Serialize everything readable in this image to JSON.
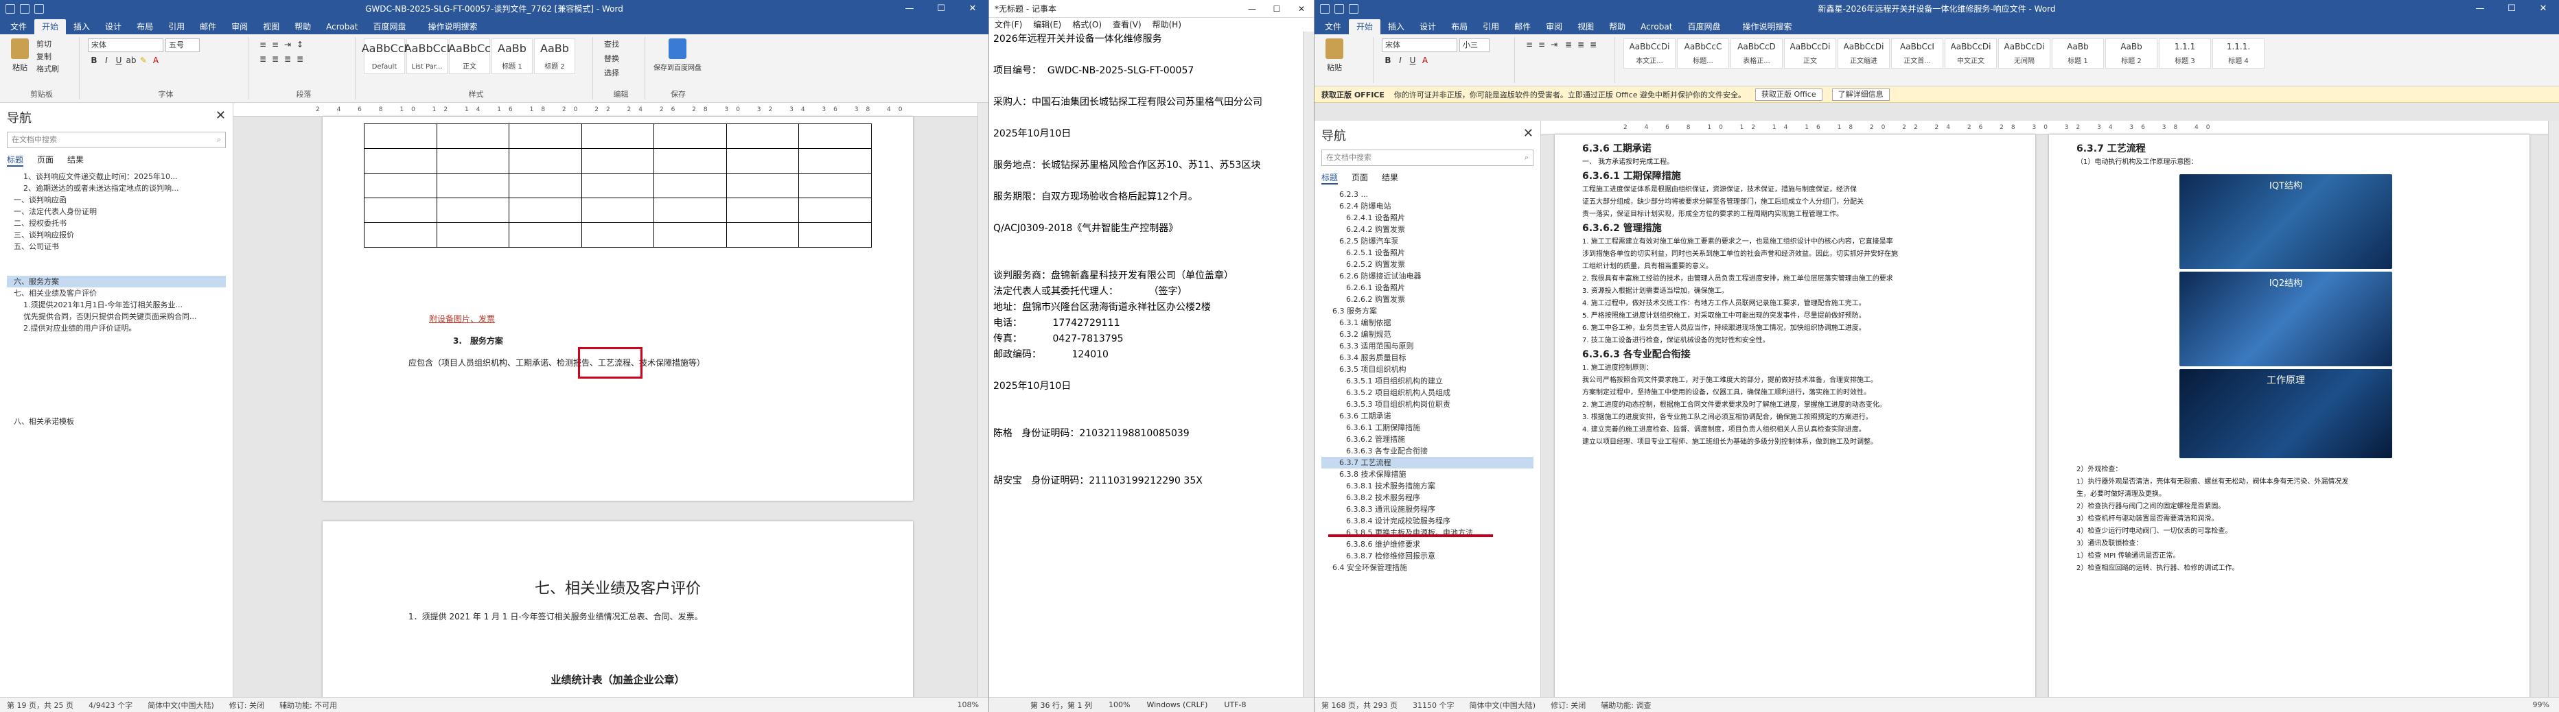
{
  "w1": {
    "title": "GWDC-NB-2025-SLG-FT-00057-谈判文件_7762 [兼容模式] - Word",
    "tabs": [
      "文件",
      "开始",
      "插入",
      "设计",
      "布局",
      "引用",
      "邮件",
      "审阅",
      "视图",
      "帮助",
      "Acrobat",
      "百度网盘",
      "操作说明搜索"
    ],
    "clipboard": {
      "paste": "粘贴",
      "cut": "剪切",
      "copy": "复制",
      "fmt": "格式刷",
      "label": "剪贴板"
    },
    "font": {
      "name": "宋体",
      "size": "五号",
      "label": "字体"
    },
    "para_label": "段落",
    "styles": [
      {
        "pv": "AaBbCcI",
        "nm": "Default"
      },
      {
        "pv": "AaBbCcI",
        "nm": "List Par..."
      },
      {
        "pv": "AaBbCc",
        "nm": "正文"
      },
      {
        "pv": "AaBb",
        "nm": "标题 1"
      },
      {
        "pv": "AaBb",
        "nm": "标题 2"
      }
    ],
    "styles_label": "样式",
    "edit": {
      "find": "查找",
      "replace": "替换",
      "select": "选择",
      "label": "编辑"
    },
    "baidu": {
      "save": "保存到百度网盘",
      "label": "保存"
    },
    "nav": {
      "title": "导航",
      "search": "在文档中搜索",
      "tabs": [
        "标题",
        "页面",
        "结果"
      ]
    },
    "nav_items": [
      "1、谈判响应文件递交截止时间：2025年10...",
      "2、逾期送达的或者未送达指定地点的谈判响...",
      "一、谈判响应函",
      "一、法定代表人身份证明",
      "二、授权委托书",
      "三、谈判响应报价",
      "五、公司证书",
      "",
      "",
      "六、服务方案",
      "七、相关业绩及客户评价",
      "1.须提供2021年1月1日-今年签订相关服务业...",
      "优先提供合同，否则只提供合同关键页面采购合同...",
      "2.提供对应业绩的用户评价证明。",
      "",
      "",
      "",
      "",
      "",
      "",
      "",
      "八、相关承诺模板"
    ],
    "doc": {
      "redline": "附设备图片、发票",
      "heading": "3.　服务方案",
      "content": "应包含（项目人员组织机构、工期承诺、检测报告、工艺流程、技术保障措施等）",
      "section": "七、相关业绩及客户评价",
      "desc": "1．须提供 2021 年 1 月 1 日-今年签订相关服务业绩情况汇总表、合同、发票。",
      "table_title": "业绩统计表（加盖企业公章）"
    },
    "status": {
      "page": "第 19 页，共 25 页",
      "words": "4/9423 个字",
      "lang": "简体中文(中国大陆)",
      "rev": "修订: 关闭",
      "acc": "辅助功能: 不可用",
      "zoom": "108%"
    }
  },
  "w2": {
    "title": "*无标题 - 记事本",
    "menu": [
      "文件(F)",
      "编辑(E)",
      "格式(O)",
      "查看(V)",
      "帮助(H)"
    ],
    "lines": [
      "2026年远程开关并设备一体化维修服务",
      "",
      "项目编号：  GWDC-NB-2025-SLG-FT-00057",
      "",
      "采购人：中国石油集团长城钻探工程有限公司苏里格气田分公司",
      "",
      "2025年10月10日",
      "",
      "服务地点：长城钻探苏里格风险合作区苏10、苏11、苏53区块",
      "",
      "服务期限：自双方现场验收合格后起算12个月。",
      "",
      "Q/ACJ0309-2018《气井智能生产控制器》",
      "",
      "",
      "谈判服务商：盘锦新鑫星科技开发有限公司（单位盖章）",
      "法定代表人或其委托代理人：          （签字）",
      "地址：盘锦市兴隆台区渤海街道永祥社区办公楼2楼",
      "电话：          17742729111",
      "传真：          0427-7813795",
      "邮政编码：          124010",
      "",
      "2025年10月10日",
      "",
      "",
      "陈格   身份证明码：210321198810085039",
      "",
      "",
      "胡安宝   身份证明码：211103199212290 35X"
    ],
    "status": {
      "pos": "第 36 行，第 1 列",
      "zoom": "100%",
      "eol": "Windows (CRLF)",
      "enc": "UTF-8"
    }
  },
  "w3": {
    "title": "新鑫星-2026年远程开关并设备一体化维修服务-响应文件 - Word",
    "tabs": [
      "文件",
      "开始",
      "插入",
      "设计",
      "布局",
      "引用",
      "邮件",
      "审阅",
      "视图",
      "帮助",
      "Acrobat",
      "百度网盘",
      "操作说明搜索"
    ],
    "font": {
      "name": "宋体",
      "size": "小三"
    },
    "styles": [
      {
        "pv": "AaBbCcDi",
        "nm": "本文正..."
      },
      {
        "pv": "AaBbCcC",
        "nm": "标题..."
      },
      {
        "pv": "AaBbCcD",
        "nm": "表格正..."
      },
      {
        "pv": "AaBbCcDi",
        "nm": "正文"
      },
      {
        "pv": "AaBbCcDi",
        "nm": "正文缩进"
      },
      {
        "pv": "AaBbCcI",
        "nm": "正文首..."
      },
      {
        "pv": "AaBbCcDi",
        "nm": "中文正文"
      },
      {
        "pv": "AaBbCcDi",
        "nm": "无间隔"
      },
      {
        "pv": "AaBb",
        "nm": "标题 1"
      },
      {
        "pv": "AaBb",
        "nm": "标题 2"
      },
      {
        "pv": "1.1.1",
        "nm": "标题 3"
      },
      {
        "pv": "1.1.1.",
        "nm": "标题 4"
      }
    ],
    "msg": {
      "label": "获取正版 OFFICE",
      "text": "你的许可证并非正版，你可能是盗版软件的受害者。立即通过正版 Office 避免中断并保护你的文件安全。",
      "btn1": "获取正版 Office",
      "btn2": "了解详细信息"
    },
    "nav": {
      "title": "导航",
      "search": "在文档中搜索",
      "tabs": [
        "标题",
        "页面",
        "结果"
      ]
    },
    "nav_items": [
      "6.2.3 ...",
      "6.2.4 防爆电站",
      "6.2.4.1 设备照片",
      "6.2.4.2 购置发票",
      "6.2.5 防爆汽车泵",
      "6.2.5.1 设备照片",
      "6.2.5.2 购置发票",
      "6.2.6 防爆接近试油电器",
      "6.2.6.1 设备照片",
      "6.2.6.2 购置发票",
      "6.3 服务方案",
      "6.3.1 编制依据",
      "6.3.2 编制规范",
      "6.3.3 适用范围与原则",
      "6.3.4 服务质量目标",
      "6.3.5 项目组织机构",
      "6.3.5.1 项目组织机构的建立",
      "6.3.5.2 项目组织机构人员组成",
      "6.3.5.3 项目组织机构岗位职责",
      "6.3.6 工期承诺",
      "6.3.6.1 工期保障措施",
      "6.3.6.2 管理措施",
      "6.3.6.3 各专业配合衔接",
      "6.3.7 工艺流程",
      "6.3.8 技术保障措施",
      "6.3.8.1 技术服务措施方案",
      "6.3.8.2 技术服务程序",
      "6.3.8.3 通讯设施服务程序",
      "6.3.8.4 设计完成校验服务程序",
      "6.3.8.5 更换主板及电源板、电池方法",
      "6.3.8.6 维护维修要求",
      "6.3.8.7 检修维修回报示意",
      "6.4 安全环保管理措施"
    ],
    "doc_left": {
      "h1": "6.3.6 工期承诺",
      "sub1": "一、 我方承诺按时完成工程。",
      "h2": "6.3.6.1 工期保障措施",
      "p1": [
        "工程施工进度保证体系是根据由组织保证，资源保证，技术保证，措施与制度保证，经济保",
        "证五大部分组成，缺少部分均将被要求分解至各管理部门，施工后组成立个人分组门，分配关",
        "责一落实，保证目标计划实现，形成全方位的要求的工程周期内实现施工程管理工作。"
      ],
      "h3": "6.3.6.2 管理措施",
      "p2": [
        "1. 施工工程需建立有效对施工单位施工要素的要求之一，也是施工组织设计中的核心内容，它直接是率",
        "涉到措施各单位的切实利益，同时也关系到施工单位的社会声誉和经济效益。因此，切实抓好并安好在施",
        "工组织计划的质量，具有相当重要的意义。",
        "2. 我很具有丰富施工经验的技术，由管理人员负责工程进度安排，施工单位层层落实管理由施工的要求",
        "3. 资源投入根据计划需要适当增加，确保施工。",
        "4. 施工过程中，做好技术交底工作：有地方工作人员联网记录施工要求，管理配合施工完工。",
        "5. 严格按照施工进度计划组织施工，对采取施工中可能出现的突发事件，尽量提前做好预防。",
        "6. 施工中各工种，业务员主管人员应当作，持续跟进现场施工情况，加快组织协调施工进度。",
        "7. 技工施工设备进行检查，保证机械设备的完好性和安全性。"
      ],
      "h4": "6.3.6.3 各专业配合衔接",
      "p3": [
        "1. 施工进度控制原则：",
        "我公司严格按照合同文件要求施工，对于施工难度大的部分，提前做好技术准备，合理安排施工。",
        "方案制定过程中，坚持施工中使用的设备，仪器工具，确保施工顺利进行，落实施工的时效性。",
        "2. 施工进度的动态控制，根据施工合同文件要求要求及时了解施工进度，掌握施工进度的动态变化。",
        "3. 根据施工的进度安排，各专业施工队之间必须互相协调配合，确保施工按照预定的方案进行。",
        "4. 建立完善的施工进度检查、监督、调度制度，项目负责人组织相关人员认真检查实际进度。",
        "建立以项目经理、项目专业工程师、施工班组长为基础的多级分别控制体系，做到施工及时调整。"
      ]
    },
    "doc_right": {
      "h1": "6.3.7 工艺流程",
      "p0": "（1）电动执行机构及工作原理示意图：",
      "img1": "IQT结构",
      "img2": "IQ2结构",
      "img3": "工作原理",
      "p1": [
        "2）外观检查：",
        "1）执行器外观是否清洁，壳体有无裂痕、螺丝有无松动，阀体本身有无污染、外漏情况发",
        "生，必要时做好清理及更换。",
        "2）检查执行器与阀门之间的固定螺栓是否紧固。",
        "3）检查机杆与驱动装置是否需要清洁和润滑。",
        "4）检查少运行时电动阀门、一切仪表的可靠检查。",
        "3）通讯及联锁检查：",
        "1）检查 MPI 传输通讯是否正常。",
        "2）检查相应回路的运转、执行器、检修的调试工作。"
      ]
    },
    "status": {
      "page": "第 168 页，共 293 页",
      "words": "31150 个字",
      "lang": "简体中文(中国大陆)",
      "rev": "修订: 关闭",
      "acc": "辅助功能: 调查",
      "zoom": "99%"
    }
  },
  "colors": {
    "word_blue": "#2b579a",
    "highlight_red": "#d0021b",
    "redline": "#c0392b"
  }
}
